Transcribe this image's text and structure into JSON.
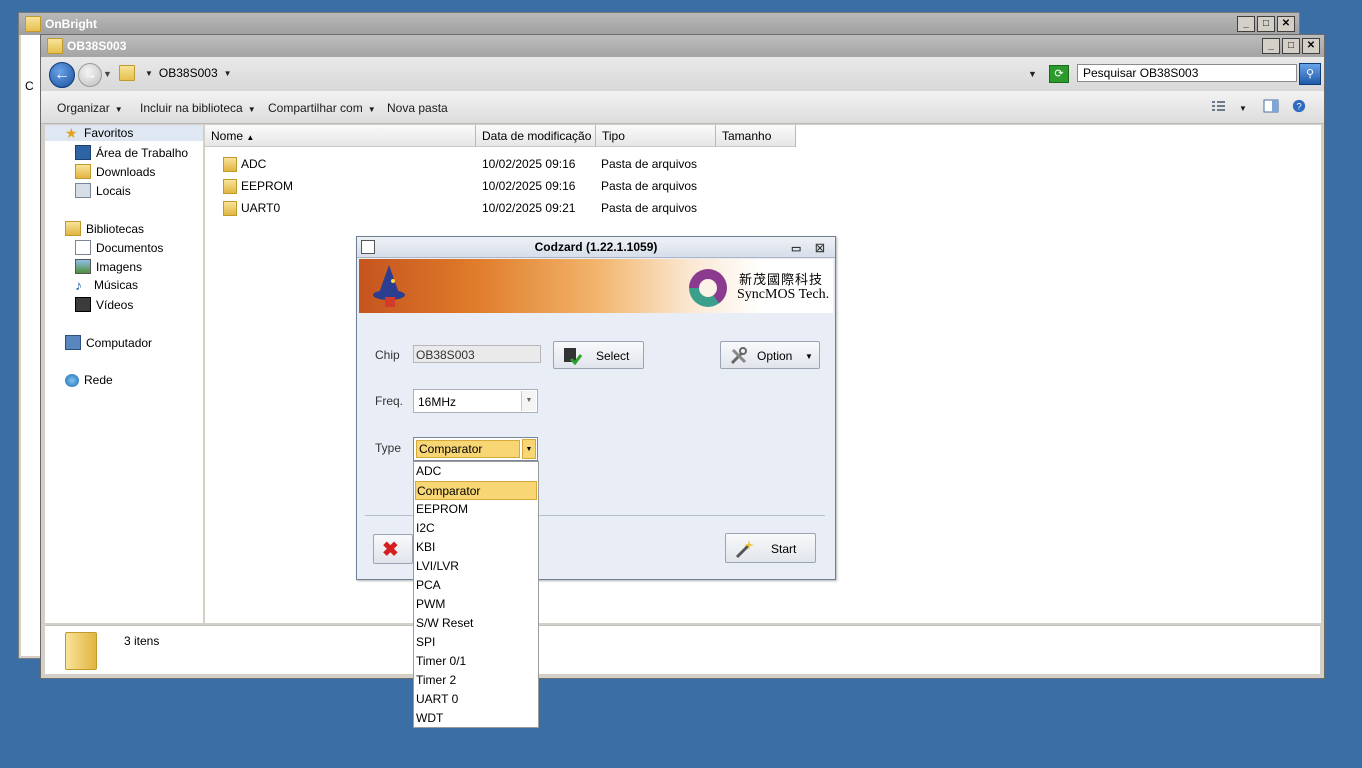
{
  "back_window": {
    "title": "OnBright",
    "side_text": "C"
  },
  "explorer": {
    "title": "OB38S003",
    "breadcrumb": "OB38S003",
    "search_placeholder": "Pesquisar OB38S003",
    "toolbar": {
      "organize": "Organizar",
      "include": "Incluir na biblioteca",
      "share": "Compartilhar com",
      "new_folder": "Nova pasta"
    },
    "nav": {
      "favorites": "Favoritos",
      "desktop": "Área de Trabalho",
      "downloads": "Downloads",
      "places": "Locais",
      "libraries": "Bibliotecas",
      "documents": "Documentos",
      "images": "Imagens",
      "music": "Músicas",
      "videos": "Vídeos",
      "computer": "Computador",
      "network": "Rede"
    },
    "columns": {
      "name": "Nome",
      "modified": "Data de modificação",
      "type": "Tipo",
      "size": "Tamanho"
    },
    "files": [
      {
        "name": "ADC",
        "date": "10/02/2025 09:16",
        "type": "Pasta de arquivos"
      },
      {
        "name": "EEPROM",
        "date": "10/02/2025 09:16",
        "type": "Pasta de arquivos"
      },
      {
        "name": "UART0",
        "date": "10/02/2025 09:21",
        "type": "Pasta de arquivos"
      }
    ],
    "status": "3 itens"
  },
  "dialog": {
    "title": "Codzard  (1.22.1.1059)",
    "brand_cn": "新茂國際科技",
    "brand_en": "SyncMOS Tech.",
    "chip_label": "Chip",
    "chip_value": "OB38S003",
    "select_label": "Select",
    "option_label": "Option",
    "freq_label": "Freq.",
    "freq_value": "16MHz",
    "type_label": "Type",
    "type_value": "Comparator",
    "start_label": "Start"
  },
  "type_options": [
    "ADC",
    "Comparator",
    "EEPROM",
    "I2C",
    "KBI",
    "LVI/LVR",
    "PCA",
    "PWM",
    "S/W Reset",
    "SPI",
    "Timer 0/1",
    "Timer 2",
    "UART 0",
    "WDT"
  ],
  "type_selected_index": 1
}
